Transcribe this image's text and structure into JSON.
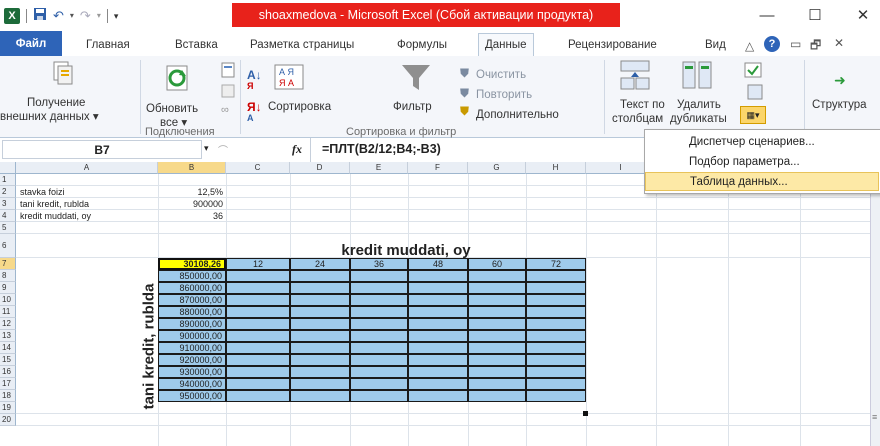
{
  "window": {
    "title": "shoaxmedova  -  Microsoft Excel (Сбой активации продукта)",
    "minimize": "—",
    "maximize": "☐",
    "close": "✕",
    "help": "?"
  },
  "tabs": [
    "Файл",
    "Главная",
    "Вставка",
    "Разметка страницы",
    "Формулы",
    "Данные",
    "Рецензирование",
    "Вид"
  ],
  "ribbon": {
    "external_data_1": "Получение",
    "external_data_2": "внешних данных ▾",
    "refresh_1": "Обновить",
    "refresh_2": "все ▾",
    "group_connections": "Подключения",
    "sort_label": "Сортировка",
    "filter_label": "Фильтр",
    "clear_label": "Очистить",
    "reapply_label": "Повторить",
    "advanced_label": "Дополнительно",
    "group_sortfilter": "Сортировка и фильтр",
    "text_to_columns_1": "Текст по",
    "text_to_columns_2": "столбцам",
    "remove_dup_1": "Удалить",
    "remove_dup_2": "дубликаты",
    "outline_label": "Структура"
  },
  "formula_bar": {
    "name_box": "B7",
    "fx": "fx",
    "formula": "=ПЛТ(B2/12;B4;-B3)"
  },
  "columns": [
    "A",
    "B",
    "C",
    "D",
    "E",
    "F",
    "G",
    "H",
    "I"
  ],
  "rows": [
    "1",
    "2",
    "3",
    "4",
    "5",
    "6",
    "7",
    "8",
    "9",
    "10",
    "11",
    "12",
    "13",
    "14",
    "15",
    "16",
    "17",
    "18",
    "19",
    "20"
  ],
  "cells": {
    "A2": "stavka foizi",
    "B2": "12,5%",
    "A3": "tani kredit, rublda",
    "B3": "900000",
    "A4": "kredit muddati, oy",
    "B4": "36",
    "header_title": "kredit muddati, oy",
    "B7": "30108,26",
    "C7": "12",
    "D7": "24",
    "E7": "36",
    "F7": "48",
    "G7": "60",
    "H7": "72",
    "B_values": [
      "850000,00",
      "860000,00",
      "870000,00",
      "880000,00",
      "890000,00",
      "900000,00",
      "910000,00",
      "920000,00",
      "930000,00",
      "940000,00",
      "950000,00"
    ],
    "vertical_label": "tani kredit, rublda"
  },
  "whatif_menu": {
    "items": [
      "Диспетчер сценариев...",
      "Подбор параметра...",
      "Таблица данных..."
    ]
  },
  "colors": {
    "title_accent": "#e8221b",
    "file_tab": "#2e64b8",
    "table_fill": "#9fcbeb",
    "active_cell": "#ffff00",
    "menu_highlight": "#fde9a6"
  }
}
